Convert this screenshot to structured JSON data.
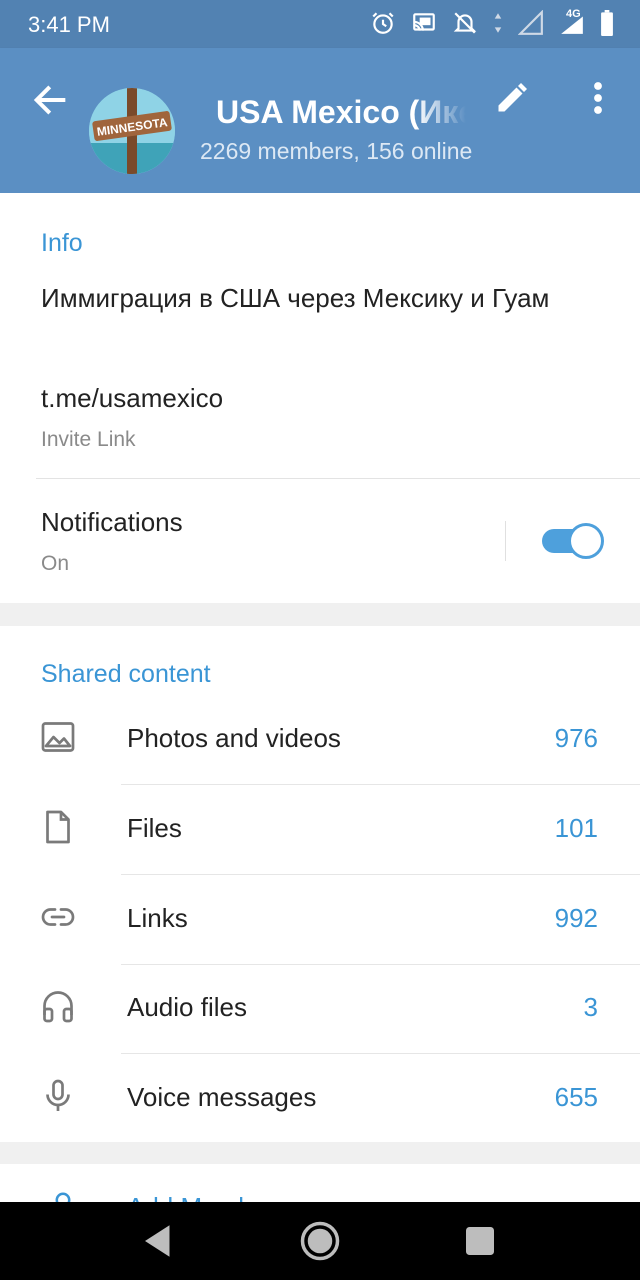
{
  "status_bar": {
    "time": "3:41 PM",
    "network": "4G",
    "icons": [
      "alarm-icon",
      "cast-icon",
      "notifications-off-icon",
      "data-arrows-icon",
      "signal-icon",
      "battery-icon"
    ]
  },
  "header": {
    "title": "USA Mexico (Икеа)",
    "subtitle": "2269 members, 156 online",
    "avatar_text": "MINNESOTA",
    "background_color": "#5b8fc3",
    "icons": [
      "back-arrow-icon",
      "edit-pencil-icon",
      "more-vert-icon"
    ]
  },
  "info": {
    "section_title": "Info",
    "description": "Иммиграция в США через Мексику и Гуам",
    "link": "t.me/usamexico",
    "link_caption": "Invite Link",
    "notifications_label": "Notifications",
    "notifications_status": "On",
    "notifications_enabled": true
  },
  "shared_content": {
    "section_title": "Shared content",
    "accent_color": "#3a95d5",
    "items": [
      {
        "icon": "photo-icon",
        "label": "Photos and videos",
        "count": "976"
      },
      {
        "icon": "file-icon",
        "label": "Files",
        "count": "101"
      },
      {
        "icon": "link-icon",
        "label": "Links",
        "count": "992"
      },
      {
        "icon": "headphones-icon",
        "label": "Audio files",
        "count": "3"
      },
      {
        "icon": "microphone-icon",
        "label": "Voice messages",
        "count": "655"
      }
    ]
  },
  "members": {
    "add_members_label": "Add Members"
  },
  "nav_bar": {
    "icons": [
      "nav-back-icon",
      "nav-home-icon",
      "nav-recents-icon"
    ]
  }
}
